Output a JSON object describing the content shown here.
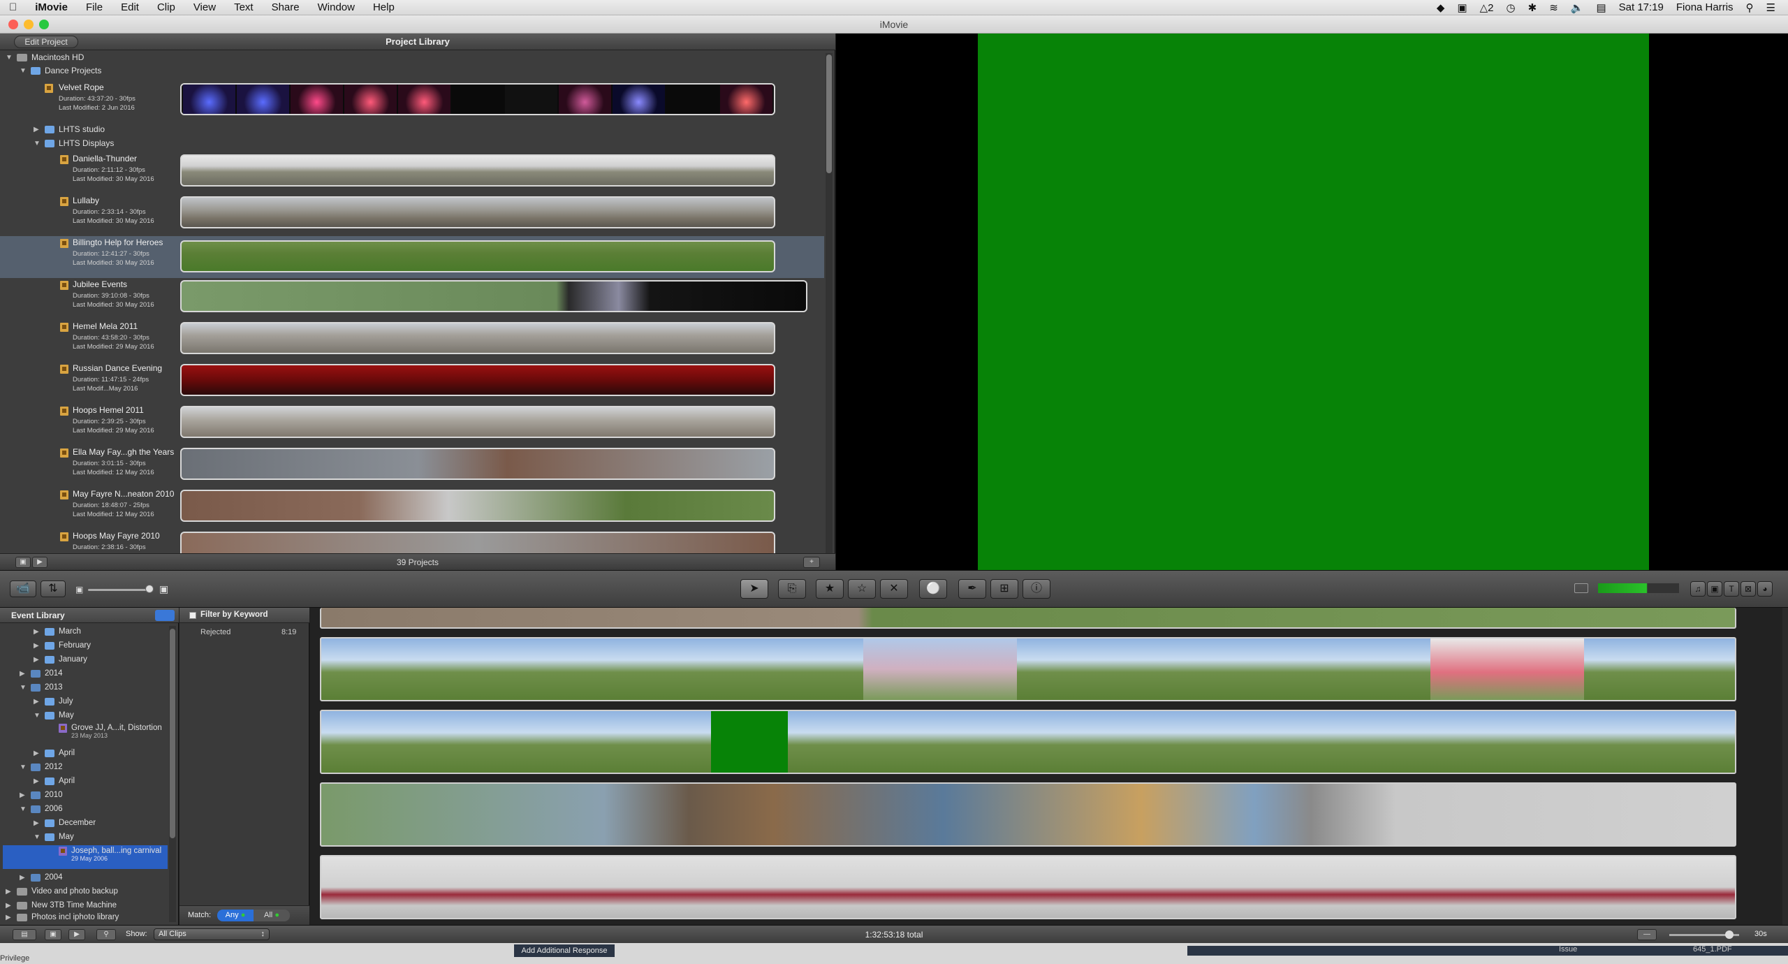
{
  "menubar": {
    "app": "iMovie",
    "items": [
      "File",
      "Edit",
      "Clip",
      "View",
      "Text",
      "Share",
      "Window",
      "Help"
    ],
    "status_num": "2",
    "clock": "Sat 17:19",
    "user": "Fiona Harris"
  },
  "window": {
    "title": "iMovie"
  },
  "project_library": {
    "edit_button": "Edit Project",
    "title": "Project Library",
    "count": "39 Projects",
    "tree": {
      "disk": "Macintosh HD",
      "dance": "Dance Projects",
      "studio": "LHTS studio",
      "displays": "LHTS Displays"
    },
    "projects": [
      {
        "name": "Velvet Rope",
        "duration": "Duration: 43:37:20 - 30fps",
        "modified": "Last Modified: 2 Jun 2016"
      },
      {
        "name": "Daniella-Thunder",
        "duration": "Duration: 2:11:12 - 30fps",
        "modified": "Last Modified: 30 May 2016"
      },
      {
        "name": "Lullaby",
        "duration": "Duration: 2:33:14 - 30fps",
        "modified": "Last Modified: 30 May 2016"
      },
      {
        "name": "Billingto Help for Heroes",
        "duration": "Duration: 12:41:27 - 30fps",
        "modified": "Last Modified: 30 May 2016"
      },
      {
        "name": "Jubilee Events",
        "duration": "Duration: 39:10:08 - 30fps",
        "modified": "Last Modified: 30 May 2016"
      },
      {
        "name": "Hemel Mela 2011",
        "duration": "Duration: 43:58:20 - 30fps",
        "modified": "Last Modified: 29 May 2016"
      },
      {
        "name": "Russian Dance Evening",
        "duration": "Duration: 11:47:15 - 24fps",
        "modified": "Last Modif...May 2016"
      },
      {
        "name": "Hoops Hemel 2011",
        "duration": "Duration: 2:39:25 - 30fps",
        "modified": "Last Modified: 29 May 2016"
      },
      {
        "name": "Ella May Fay...gh the Years",
        "duration": "Duration: 3:01:15 - 30fps",
        "modified": "Last Modified: 12 May 2016"
      },
      {
        "name": "May Fayre N...neaton 2010",
        "duration": "Duration: 18:48:07 - 25fps",
        "modified": "Last Modified: 12 May 2016"
      },
      {
        "name": "Hoops May Fayre 2010",
        "duration": "Duration: 2:38:16 - 30fps",
        "modified": ""
      }
    ]
  },
  "event_library": {
    "title": "Event Library",
    "rows": {
      "march": "March",
      "february": "February",
      "january": "January",
      "y2014": "2014",
      "y2013": "2013",
      "july": "July",
      "may": "May",
      "grove": "Grove JJ, A...it, Distortion",
      "grove_date": "23 May 2013",
      "april": "April",
      "y2012": "2012",
      "april2": "April",
      "y2010": "2010",
      "y2006": "2006",
      "december": "December",
      "may2": "May",
      "joseph": "Joseph, ball...ing carnival",
      "joseph_date": "29 May 2006",
      "y2004": "2004",
      "backup": "Video and photo backup",
      "tm": "New 3TB Time Machine",
      "photos": "Photos incl iphoto library"
    }
  },
  "keyword_filter": {
    "title": "Filter by Keyword",
    "rejected": "Rejected",
    "rejected_duration": "8:19",
    "match_label": "Match:",
    "any": "Any",
    "all": "All"
  },
  "status": {
    "show_label": "Show:",
    "show_value": "All Clips",
    "total": "1:32:53:18 total",
    "scale": "30s"
  },
  "below": {
    "add_response": "Add Additional Response",
    "issue": "Issue",
    "pdf": "645_1.PDF",
    "privilege": "Privilege"
  },
  "colors": {
    "video_green": "#078307",
    "selection_blue": "#2a5fc2"
  }
}
